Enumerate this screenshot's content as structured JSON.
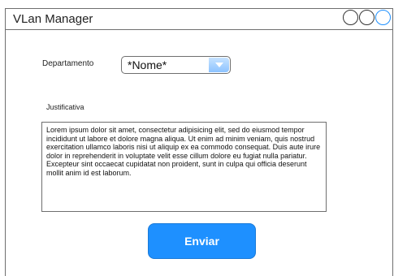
{
  "window": {
    "title": "VLan Manager",
    "buttons": [
      "window-button",
      "window-button",
      "window-button-active"
    ]
  },
  "form": {
    "departamento_label": "Departamento",
    "departamento_value": "*Nome*",
    "justificativa_label": "Justificativa",
    "justificativa_text": "Lorem ipsum dolor sit amet, consectetur adipisicing elit, sed do eiusmod tempor incididunt ut labore et dolore magna aliqua. Ut enim ad minim veniam, quis nostrud exercitation ullamco laboris nisi ut aliquip ex ea commodo consequat. Duis aute irure dolor in reprehenderit in voluptate velit esse cillum dolore eu fugiat nulla pariatur. Excepteur sint occaecat cupidatat non proident, sunt in culpa qui officia deserunt mollit anim id est laborum.",
    "submit_label": "Enviar"
  },
  "colors": {
    "accent": "#1e90ff",
    "border": "#6f6f6f"
  }
}
